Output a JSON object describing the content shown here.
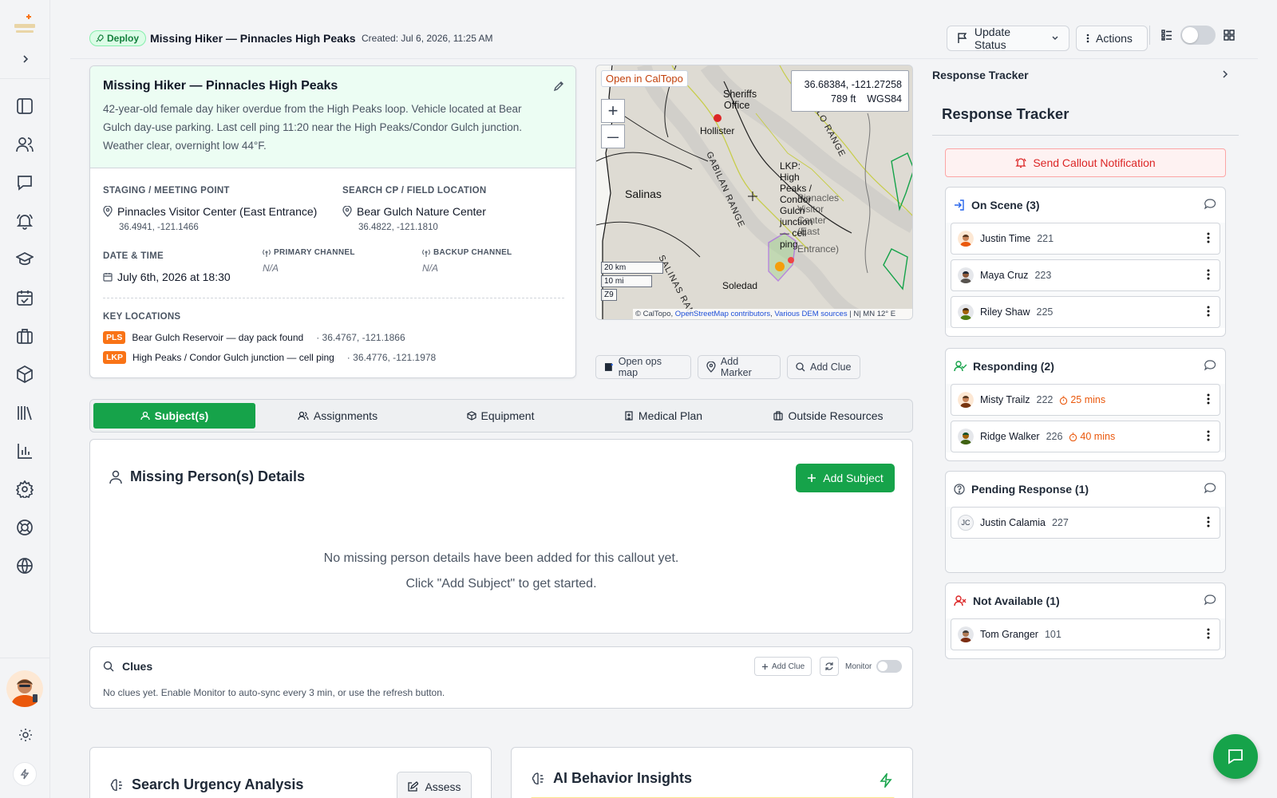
{
  "header": {
    "badge": "Deploy",
    "title": "Missing Hiker — Pinnacles High Peaks",
    "created": "Created: Jul 6, 2026, 11:25 AM",
    "update_status": "Update Status",
    "actions": "Actions"
  },
  "summary": {
    "title": "Missing Hiker — Pinnacles High Peaks",
    "description": "42-year-old female day hiker overdue from the High Peaks loop. Vehicle located at Bear Gulch day-use parking. Last cell ping 11:20 near the High Peaks/Condor Gulch junction. Weather clear, overnight low 44°F.",
    "staging_label": "STAGING / MEETING POINT",
    "staging_name": "Pinnacles Visitor Center (East Entrance)",
    "staging_coords": "36.4941, -121.1466",
    "cp_label": "SEARCH CP / FIELD LOCATION",
    "cp_name": "Bear Gulch Nature Center",
    "cp_coords": "36.4822, -121.1810",
    "datetime_label": "DATE & TIME",
    "datetime": "July 6th, 2026 at 18:30",
    "primary_label": "PRIMARY CHANNEL",
    "primary_value": "N/A",
    "backup_label": "BACKUP CHANNEL",
    "backup_value": "N/A",
    "key_locations_label": "KEY LOCATIONS",
    "key_locations": [
      {
        "tag": "PLS",
        "name": "Bear Gulch Reservoir — day pack found",
        "coords": "36.4767, -121.1866"
      },
      {
        "tag": "LKP",
        "name": "High Peaks / Condor Gulch junction — cell ping",
        "coords": "36.4776, -121.1978"
      }
    ]
  },
  "map": {
    "open_link": "Open in CalTopo",
    "coords": "36.68384, -121.27258",
    "elevation": "789 ft",
    "datum": "WGS84",
    "zoom_in": "+",
    "zoom_out": "—",
    "scale_km": "20 km",
    "scale_mi": "10 mi",
    "zoom_level": "Z9",
    "attribution_prefix": "© CalTopo,",
    "attribution_osm": "OpenStreetMap contributors",
    "attribution_dem": "Various DEM sources",
    "attribution_mn": "| N| MN 12° E",
    "labels": {
      "sheriffs": "Sheriffs",
      "office": "Office",
      "hollister": "Hollister",
      "salinas": "Salinas",
      "soledad": "Soledad",
      "diablo": "DIABLO RANGE",
      "gabilan": "GABILAN RANGE",
      "salinas_range": "SALINAS RAN",
      "lkp_lines": [
        "LKP:",
        "High",
        "Peaks /",
        "Condor",
        "Gulch",
        "junction",
        "— cell",
        "ping"
      ],
      "pinnacles_lines": [
        "Pinnacles",
        "Visitor",
        "Center",
        "(East",
        "Entrance)"
      ]
    },
    "buttons": {
      "ops_map": "Open ops map",
      "add_marker": "Add Marker",
      "add_clue": "Add Clue"
    }
  },
  "tabs": [
    "Subject(s)",
    "Assignments",
    "Equipment",
    "Medical Plan",
    "Outside Resources"
  ],
  "subject_panel": {
    "title": "Missing Person(s) Details",
    "add_button": "Add Subject",
    "empty_line1": "No missing person details have been added for this callout yet.",
    "empty_line2": "Click \"Add Subject\" to get started."
  },
  "clues": {
    "title": "Clues",
    "add_button": "Add Clue",
    "monitor_label": "Monitor",
    "empty": "No clues yet. Enable Monitor to auto-sync every 3 min, or use the refresh button."
  },
  "urgency": {
    "title": "Search Urgency Analysis",
    "assess": "Assess"
  },
  "ai_insights": {
    "title": "AI Behavior Insights"
  },
  "tracker": {
    "header": "Response Tracker",
    "title": "Response Tracker",
    "callout_button": "Send Callout Notification",
    "groups": {
      "on_scene": {
        "title": "On Scene (3)",
        "members": [
          {
            "name": "Justin Time",
            "num": "221"
          },
          {
            "name": "Maya Cruz",
            "num": "223"
          },
          {
            "name": "Riley Shaw",
            "num": "225"
          }
        ]
      },
      "responding": {
        "title": "Responding (2)",
        "members": [
          {
            "name": "Misty Trailz",
            "num": "222",
            "eta": "25 mins"
          },
          {
            "name": "Ridge Walker",
            "num": "226",
            "eta": "40 mins"
          }
        ]
      },
      "pending": {
        "title": "Pending Response (1)",
        "members": [
          {
            "initials": "JC",
            "name": "Justin Calamia",
            "num": "227"
          }
        ]
      },
      "not_available": {
        "title": "Not Available (1)",
        "members": [
          {
            "name": "Tom Granger",
            "num": "101"
          }
        ]
      }
    }
  },
  "colors": {
    "accent_green": "#16a34a",
    "danger_red": "#dc2626",
    "eta_orange": "#ea580c",
    "tag_orange": "#f97316"
  }
}
